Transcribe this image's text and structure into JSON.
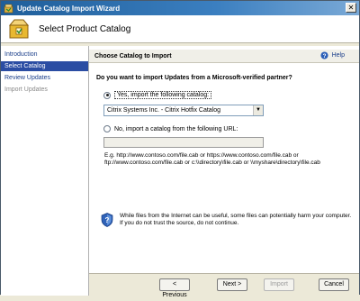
{
  "window": {
    "title": "Update Catalog Import Wizard"
  },
  "header": {
    "title": "Select Product Catalog"
  },
  "sidebar": {
    "items": [
      {
        "label": "Introduction",
        "state": "link"
      },
      {
        "label": "Select Catalog",
        "state": "selected"
      },
      {
        "label": "Review Updates",
        "state": "link"
      },
      {
        "label": "Import Updates",
        "state": "disabled"
      }
    ]
  },
  "section": {
    "title": "Choose Catalog to Import",
    "help_label": "Help"
  },
  "question": "Do you want to import Updates from a Microsoft-verified partner?",
  "option_yes": {
    "label": "Yes, import the following catalog:",
    "checked": true
  },
  "catalog_select": {
    "value": "Citrix Systems Inc. - Citrix Hotfix Catalog"
  },
  "option_no": {
    "label": "No, import a catalog from the following URL:",
    "checked": false
  },
  "url_input": {
    "value": ""
  },
  "example_text": "E.g. http://www.contoso.com/file.cab or https://www.contoso.com/file.cab or ftp://www.contoso.com/file.cab or c:\\\\directory\\file.cab or \\\\myshare\\directory\\file.cab",
  "warning_text": "While files from the Internet can be useful, some files can potentially harm your computer.  If you do not trust the source, do not continue.",
  "buttons": {
    "previous": "< Previous",
    "next": "Next >",
    "import": "Import",
    "cancel": "Cancel"
  },
  "colors": {
    "titlebar": "#1f5e9a",
    "selected_nav": "#2b4da3",
    "link": "#1a3e8a"
  },
  "icons": {
    "app": "wizard-app-icon",
    "header": "catalog-wizard-icon",
    "help": "help-icon",
    "warning": "security-shield-icon"
  }
}
